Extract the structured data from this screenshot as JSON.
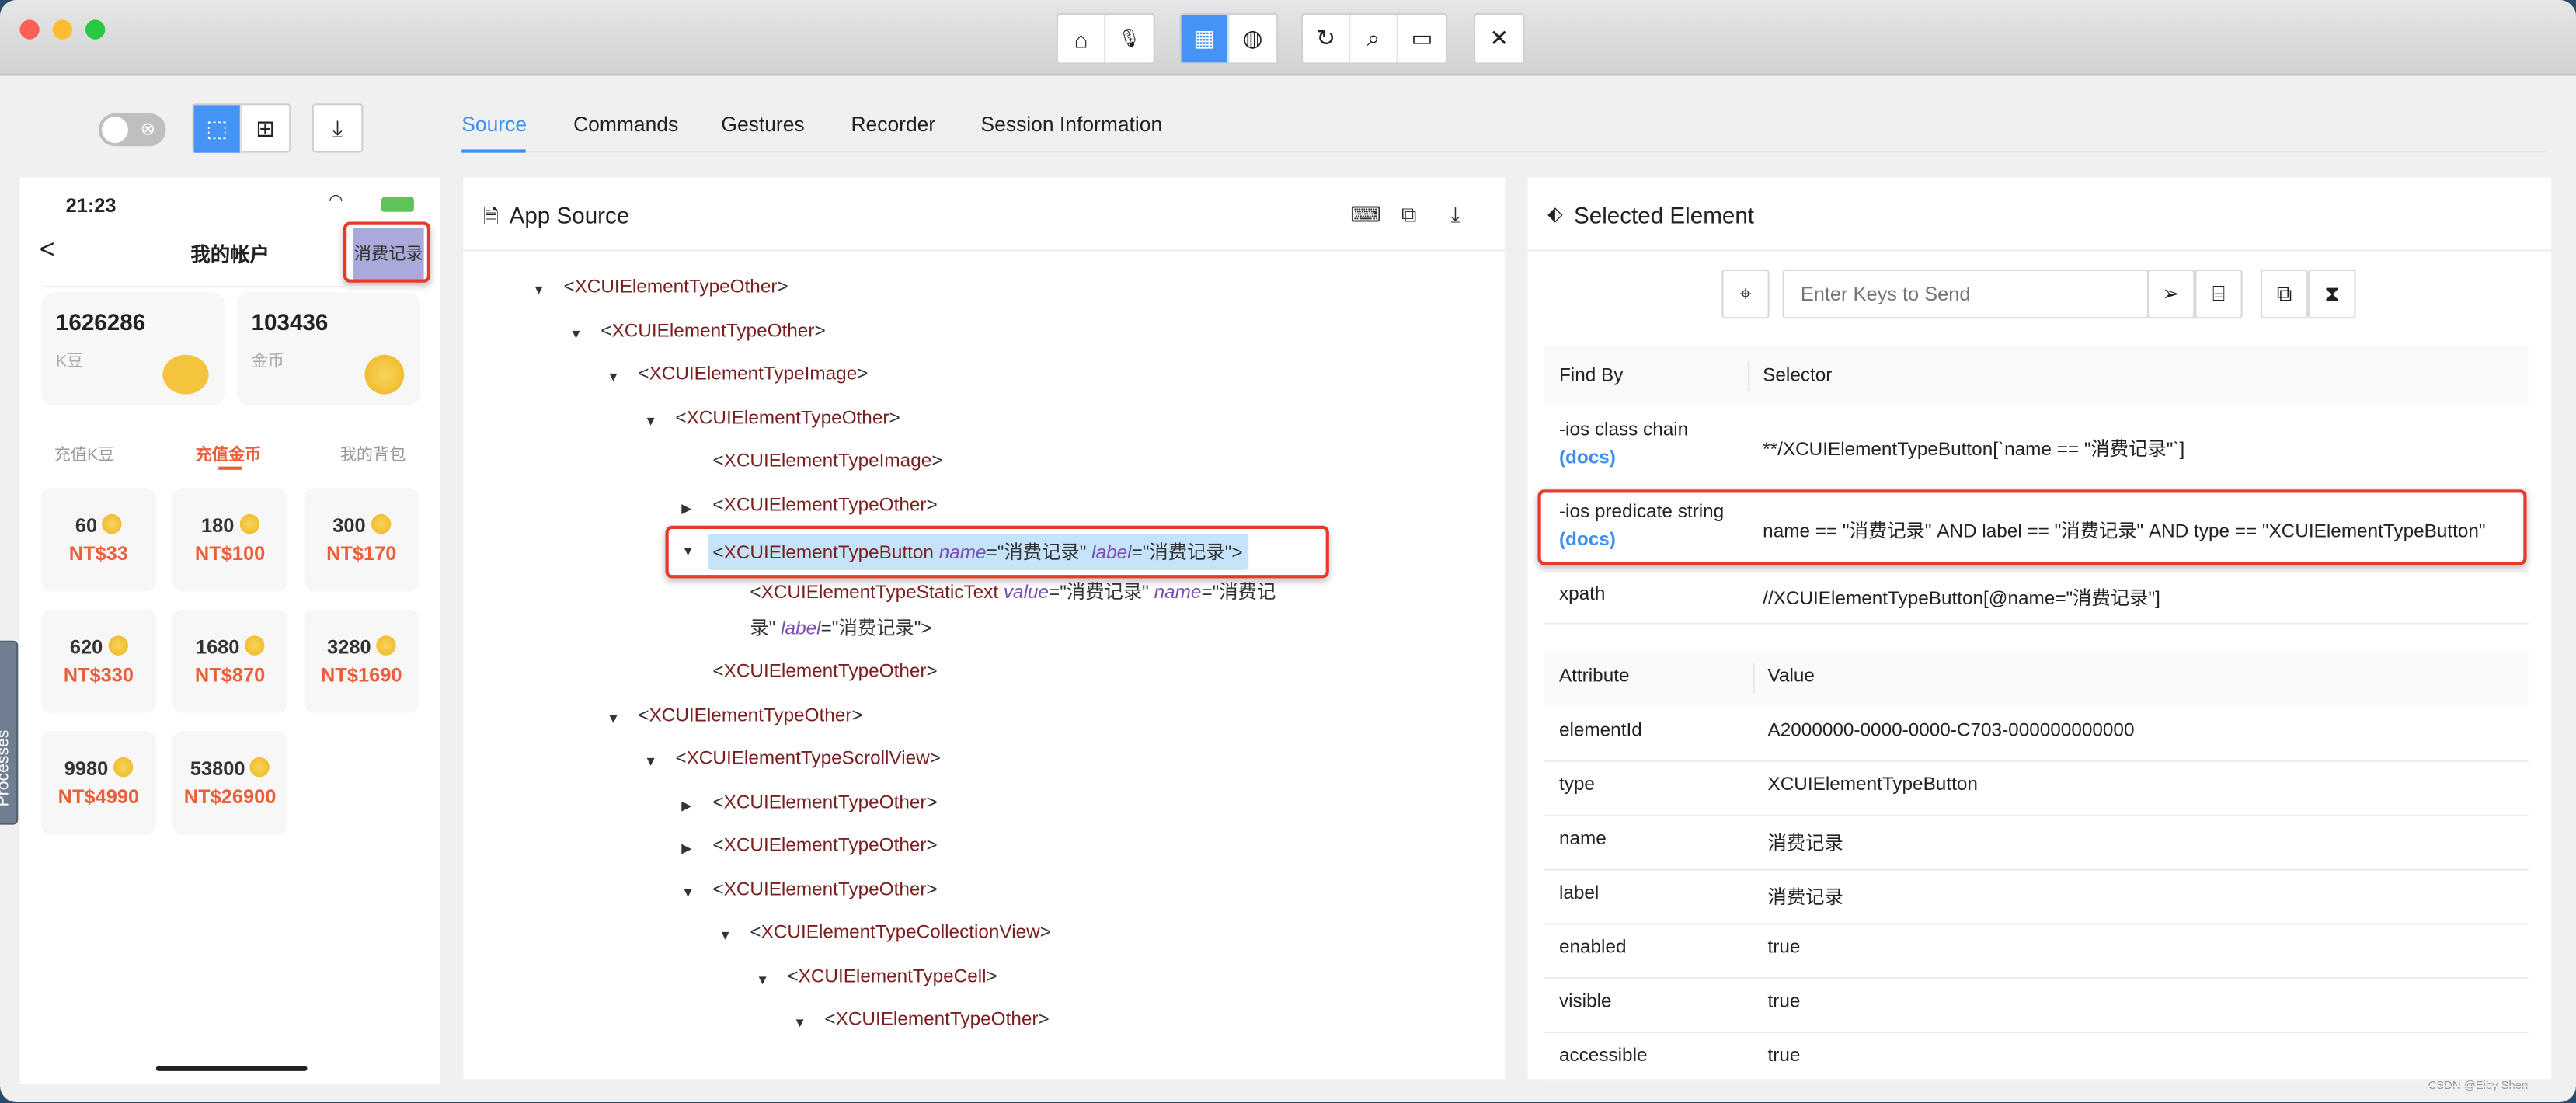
{
  "toolbar": {
    "buttons": [
      "home-icon",
      "microphone-icon",
      "grid-icon",
      "globe-icon",
      "refresh-icon",
      "search-icon",
      "record-icon",
      "close-icon"
    ],
    "glyphs": {
      "home": "⌂",
      "mic": "🎙",
      "grid": "▦",
      "globe": "◍",
      "refresh": "↻",
      "search": "⌕",
      "record": "▭",
      "close": "✕"
    }
  },
  "mode": {
    "toggle_glyph": "⊗",
    "select_glyph": "⬚",
    "add_glyph": "⊞",
    "download_glyph": "⤓"
  },
  "tabs": [
    "Source",
    "Commands",
    "Gestures",
    "Recorder",
    "Session Information"
  ],
  "active_tab": "Source",
  "phone": {
    "time": "21:23",
    "title": "我的帐户",
    "back": "<",
    "record_button": "消费记录",
    "balances": [
      {
        "value": "1626286",
        "label": "K豆"
      },
      {
        "value": "103436",
        "label": "金币"
      }
    ],
    "subtabs": [
      "充值K豆",
      "充值金币",
      "我的背包"
    ],
    "active_subtab": "充值金币",
    "packages": [
      {
        "amount": "60",
        "price": "NT$33"
      },
      {
        "amount": "180",
        "price": "NT$100"
      },
      {
        "amount": "300",
        "price": "NT$170"
      },
      {
        "amount": "620",
        "price": "NT$330"
      },
      {
        "amount": "1680",
        "price": "NT$870"
      },
      {
        "amount": "3280",
        "price": "NT$1690"
      },
      {
        "amount": "9980",
        "price": "NT$4990"
      },
      {
        "amount": "53800",
        "price": "NT$26900"
      }
    ]
  },
  "processes_tab": "Processes",
  "source": {
    "title": "App Source",
    "tree": [
      {
        "level": 0,
        "arrow": "down",
        "tag": "XCUIElementTypeOther",
        "attrs": []
      },
      {
        "level": 1,
        "arrow": "down",
        "tag": "XCUIElementTypeOther",
        "attrs": []
      },
      {
        "level": 2,
        "arrow": "down",
        "tag": "XCUIElementTypeImage",
        "attrs": []
      },
      {
        "level": 3,
        "arrow": "down",
        "tag": "XCUIElementTypeOther",
        "attrs": []
      },
      {
        "level": 4,
        "arrow": "none",
        "tag": "XCUIElementTypeImage",
        "attrs": []
      },
      {
        "level": 4,
        "arrow": "right",
        "tag": "XCUIElementTypeOther",
        "attrs": []
      },
      {
        "level": 4,
        "arrow": "down",
        "tag": "XCUIElementTypeButton",
        "attrs": [
          {
            "name": "name",
            "value": "消费记录"
          },
          {
            "name": "label",
            "value": "消费记录"
          }
        ],
        "selected": true
      },
      {
        "level": 5,
        "arrow": "none",
        "tag": "XCUIElementTypeStaticText",
        "attrs": [
          {
            "name": "value",
            "value": "消费记录"
          },
          {
            "name": "name",
            "value": "消费记录"
          },
          {
            "name": "label",
            "value": "消费记录"
          }
        ]
      },
      {
        "level": 4,
        "arrow": "none",
        "tag": "XCUIElementTypeOther",
        "attrs": []
      },
      {
        "level": 2,
        "arrow": "down",
        "tag": "XCUIElementTypeOther",
        "attrs": []
      },
      {
        "level": 3,
        "arrow": "down",
        "tag": "XCUIElementTypeScrollView",
        "attrs": []
      },
      {
        "level": 4,
        "arrow": "right",
        "tag": "XCUIElementTypeOther",
        "attrs": []
      },
      {
        "level": 4,
        "arrow": "right",
        "tag": "XCUIElementTypeOther",
        "attrs": []
      },
      {
        "level": 4,
        "arrow": "down",
        "tag": "XCUIElementTypeOther",
        "attrs": []
      },
      {
        "level": 5,
        "arrow": "down",
        "tag": "XCUIElementTypeCollectionView",
        "attrs": []
      },
      {
        "level": 6,
        "arrow": "down",
        "tag": "XCUIElementTypeCell",
        "attrs": []
      },
      {
        "level": 7,
        "arrow": "down",
        "tag": "XCUIElementTypeOther",
        "attrs": []
      }
    ]
  },
  "selected": {
    "title": "Selected Element",
    "keys_placeholder": "Enter Keys to Send",
    "find_by_header": "Find By",
    "selector_header": "Selector",
    "docs_label": "(docs)",
    "selectors": [
      {
        "strategy": "-ios class chain",
        "docs": true,
        "selector": "**/XCUIElementTypeButton[`name == \"消费记录\"`]"
      },
      {
        "strategy": "-ios predicate string",
        "docs": true,
        "selector": "name == \"消费记录\" AND label == \"消费记录\" AND type == \"XCUIElementTypeButton\""
      },
      {
        "strategy": "xpath",
        "docs": false,
        "selector": "//XCUIElementTypeButton[@name=\"消费记录\"]"
      }
    ],
    "attribute_header": "Attribute",
    "value_header": "Value",
    "attributes": [
      {
        "name": "elementId",
        "value": "A2000000-0000-0000-C703-000000000000"
      },
      {
        "name": "type",
        "value": "XCUIElementTypeButton"
      },
      {
        "name": "name",
        "value": "消费记录"
      },
      {
        "name": "label",
        "value": "消费记录"
      },
      {
        "name": "enabled",
        "value": "true"
      },
      {
        "name": "visible",
        "value": "true"
      },
      {
        "name": "accessible",
        "value": "true"
      }
    ]
  },
  "watermark": "CSDN @Eiby Shen",
  "colors": {
    "accent": "#3c8ff2",
    "highlight": "#e8392b",
    "price": "#ec5e3a",
    "selected_row": "#c5e4fa"
  }
}
